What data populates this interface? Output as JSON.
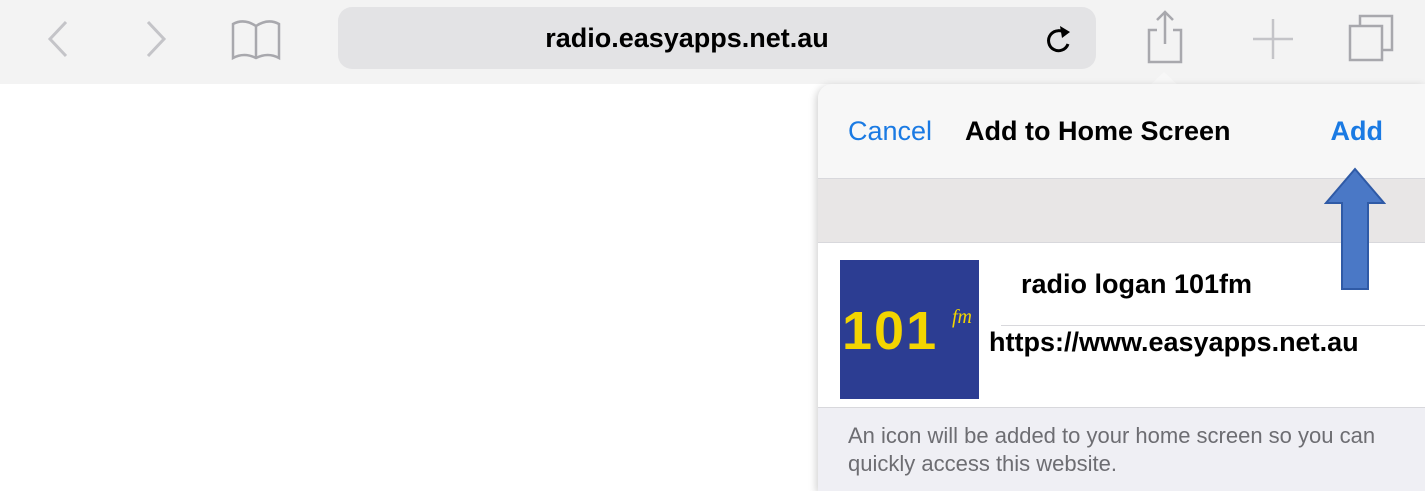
{
  "browser": {
    "url": "radio.easyapps.net.au",
    "icons": [
      "back-icon",
      "forward-icon",
      "bookmarks-icon",
      "reload-icon",
      "share-icon",
      "new-tab-icon",
      "tabs-icon"
    ]
  },
  "popover": {
    "cancel_label": "Cancel",
    "title": "Add to Home Screen",
    "add_label": "Add",
    "app_icon": {
      "number": "101",
      "suffix": "fm"
    },
    "app_name": "radio logan 101fm",
    "app_url": "https://www.easyapps.net.au",
    "description": "An icon will be added to your home screen so you can quickly access this website."
  },
  "colors": {
    "accent": "#1a7ae3",
    "annotation_arrow": "#4a78c6",
    "icon_background": "#2c3d92",
    "icon_text": "#f3d500"
  }
}
